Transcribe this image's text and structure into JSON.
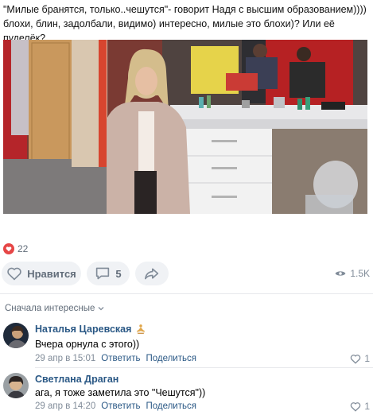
{
  "post": {
    "text": "\"Милые бранятся, только..чешутся\"- говорит Надя с высшим образованием)))) блохи, блин, задолбали, видимо) интересно, милые это блохи)? Или её пуделёк?"
  },
  "reactions": {
    "likes_count": "22"
  },
  "actions": {
    "like_label": "Нравится",
    "comments_count": "5",
    "views_count": "1.5K"
  },
  "comments_sort": {
    "label": "Сначала интересные"
  },
  "comments": [
    {
      "author": "Наталья Царевская",
      "text": "Вчера орнула с этого))",
      "date": "29 апр в 15:01",
      "reply_label": "Ответить",
      "share_label": "Поделиться",
      "likes": "1"
    },
    {
      "author": "Светлана Драган",
      "text": "ага, я тоже заметила это \"Чешутся\"))",
      "date": "29 апр в 14:20",
      "reply_label": "Ответить",
      "share_label": "Поделиться",
      "likes": "1"
    }
  ],
  "colors": {
    "accent_heart": "#e64646",
    "link": "#2a5885",
    "muted": "#818c99",
    "pill_bg": "#f0f2f5"
  }
}
